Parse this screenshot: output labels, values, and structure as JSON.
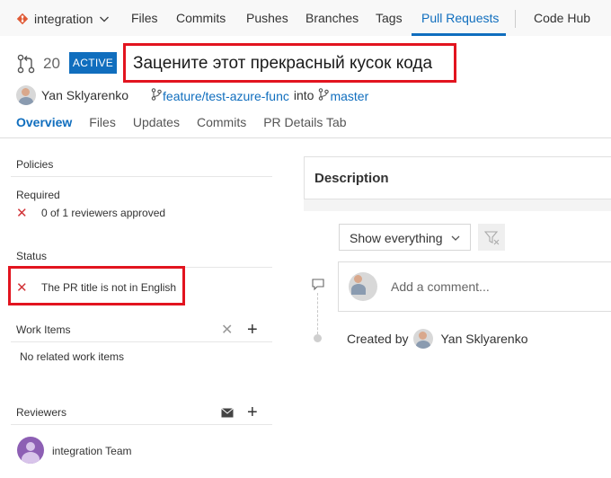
{
  "topnav": {
    "repo_name": "integration",
    "items": [
      "Files",
      "Commits",
      "Pushes",
      "Branches",
      "Tags",
      "Pull Requests"
    ],
    "active_item": "Pull Requests",
    "code_hub": "Code Hub"
  },
  "pr": {
    "id": "20",
    "status_badge": "ACTIVE",
    "title": "Зацените этот прекрасный кусок кода",
    "author": "Yan Sklyarenko",
    "source_branch": "feature/test-azure-func",
    "into_label": "into",
    "target_branch": "master"
  },
  "tabs": [
    "Overview",
    "Files",
    "Updates",
    "Commits",
    "PR Details Tab"
  ],
  "left": {
    "policies": {
      "title": "Policies",
      "required_label": "Required",
      "required_item": "0 of 1 reviewers approved"
    },
    "status": {
      "title": "Status",
      "item": "The PR title is not in English"
    },
    "work_items": {
      "title": "Work Items",
      "empty": "No related work items"
    },
    "reviewers": {
      "title": "Reviewers",
      "team": "integration Team"
    }
  },
  "right": {
    "description_title": "Description",
    "filter_selected": "Show everything",
    "comment_placeholder": "Add a comment...",
    "created_by_label": "Created by",
    "created_by_name": "Yan Sklyarenko"
  },
  "colors": {
    "accent": "#106ebe",
    "highlight_box": "#e2141f",
    "error_x": "#d13438",
    "repo_icon": "#e05a35"
  },
  "icons": [
    "repo-icon",
    "chevron-down-icon",
    "pull-request-icon",
    "branch-icon",
    "close-icon",
    "add-icon",
    "mail-icon",
    "filter-icon",
    "comment-icon",
    "team-avatar"
  ]
}
